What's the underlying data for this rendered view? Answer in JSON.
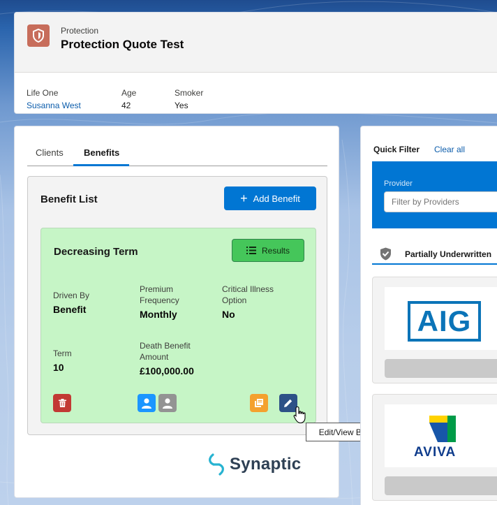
{
  "record": {
    "object_label": "Protection",
    "title": "Protection Quote Test",
    "fields": [
      {
        "label": "Life One",
        "value": "Susanna West",
        "is_link": true
      },
      {
        "label": "Age",
        "value": "42",
        "is_link": false
      },
      {
        "label": "Smoker",
        "value": "Yes",
        "is_link": false
      }
    ]
  },
  "tabs": [
    {
      "label": "Clients",
      "active": false
    },
    {
      "label": "Benefits",
      "active": true
    }
  ],
  "benefit_list": {
    "title": "Benefit List",
    "add_label": "Add Benefit"
  },
  "benefit": {
    "name": "Decreasing Term",
    "results_label": "Results",
    "fields": {
      "driven_by": {
        "label": "Driven By",
        "value": "Benefit"
      },
      "premium_frequency": {
        "label": "Premium Frequency",
        "value": "Monthly"
      },
      "critical_illness": {
        "label": "Critical Illness Option",
        "value": "No"
      },
      "term": {
        "label": "Term",
        "value": "10"
      },
      "death_benefit": {
        "label": "Death Benefit Amount",
        "value": "£100,000.00"
      }
    },
    "actions": [
      {
        "icon": "trash-icon",
        "color": "#c23934"
      },
      {
        "icon": "user-icon",
        "color": "#1b96ff"
      },
      {
        "icon": "user-icon",
        "color": "#939393"
      },
      {
        "icon": "copy-icon",
        "color": "#f4a12e"
      },
      {
        "icon": "pencil-icon",
        "color": "#2d5187"
      }
    ]
  },
  "tooltip": "Edit/View Benefit",
  "brand": "Synaptic",
  "quick_filter": {
    "label": "Quick Filter",
    "clear_label": "Clear all",
    "provider_label": "Provider",
    "provider_placeholder": "Filter by Providers"
  },
  "underwritten_label": "Partially Underwritten",
  "providers": [
    "AIG",
    "AVIVA"
  ],
  "colors": {
    "accent": "#0176d3",
    "benefit_card": "#c6f5c6",
    "results_button": "#45c65a"
  }
}
